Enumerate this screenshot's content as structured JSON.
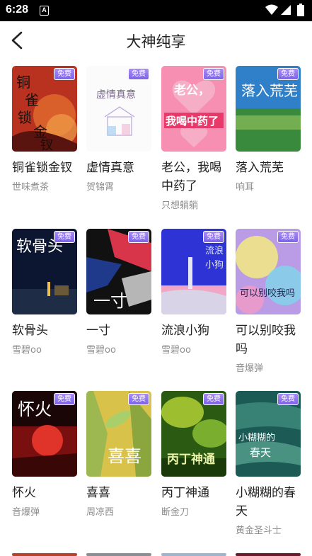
{
  "status": {
    "time": "6:28",
    "notif": "A"
  },
  "header": {
    "title": "大神纯享"
  },
  "badge": "免费",
  "rows": [
    [
      {
        "title": "铜雀锁金钗",
        "author": "世味煮茶",
        "cover_text": "铜雀锁金钗"
      },
      {
        "title": "虚情真意",
        "author": "贺锦霄",
        "cover_text": "虚情真意"
      },
      {
        "title": "老公，我喝中药了",
        "author": "只想躺躺",
        "cover_text": "老公，我喝中药了"
      },
      {
        "title": "落入荒芜",
        "author": "响耳",
        "cover_text": "落入荒芜"
      }
    ],
    [
      {
        "title": "软骨头",
        "author": "雪碧oo",
        "cover_text": "软骨头"
      },
      {
        "title": "一寸",
        "author": "雪碧oo",
        "cover_text": "一寸"
      },
      {
        "title": "流浪小狗",
        "author": "雪碧oo",
        "cover_text": "流浪小狗"
      },
      {
        "title": "可以别咬我吗",
        "author": "音爆弹",
        "cover_text": "可以别咬我吗"
      }
    ],
    [
      {
        "title": "怀火",
        "author": "音爆弹",
        "cover_text": "怀火"
      },
      {
        "title": "喜喜",
        "author": "周凉西",
        "cover_text": "喜喜"
      },
      {
        "title": "丙丁神通",
        "author": "断金刀",
        "cover_text": "丙丁神通"
      },
      {
        "title": "小糊糊的春天",
        "author": "黄金圣斗士",
        "cover_text": "小糊糊的春天"
      }
    ]
  ]
}
